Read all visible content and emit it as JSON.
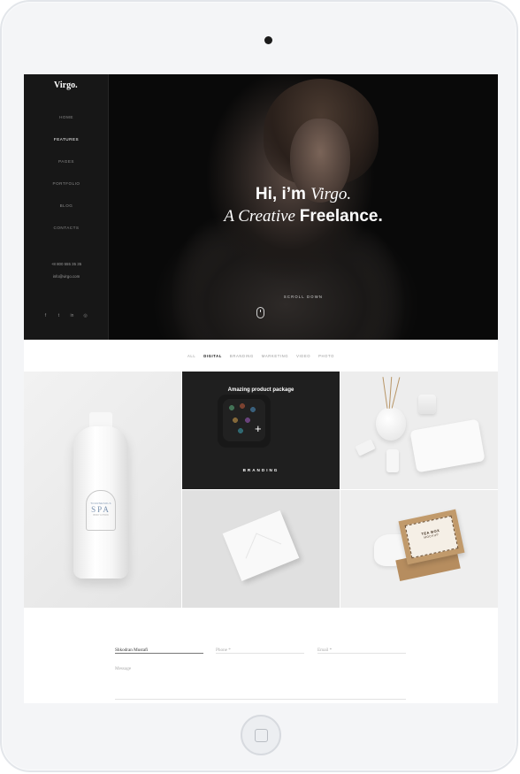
{
  "site": {
    "logo": "Virgo.",
    "nav": [
      "HOME",
      "FEATURES",
      "PAGES",
      "PORTFOLIO",
      "BLOG",
      "CONTACTS"
    ],
    "active_nav": "FEATURES",
    "phone": "+8 800 555 35 35",
    "email": "info@virgo.com",
    "socials": [
      "facebook-icon",
      "twitter-icon",
      "linkedin-icon",
      "instagram-icon"
    ]
  },
  "hero": {
    "greeting": "Hi, i’m",
    "name": "Virgo.",
    "line2_italic": "A Creative",
    "line2_bold": "Freelance.",
    "scroll_label": "SCROLL DOWN"
  },
  "filters": {
    "items": [
      "ALL",
      "DIGITAL",
      "BRANDING",
      "MARKETING",
      "VIDEO",
      "PHOTO"
    ],
    "active": "DIGITAL"
  },
  "portfolio": {
    "spa_brand": "TOURNESOLS",
    "spa_word": "SPA",
    "spa_sub": "BODY LOTION",
    "featured_title": "Amazing product  package",
    "featured_category": "BRANDING",
    "box_label_1": "TEA BOX",
    "box_label_2": "MOCKUP"
  },
  "form": {
    "name_value": "Shkodran Mustafi",
    "phone_placeholder": "Phone *",
    "email_placeholder": "Email *",
    "message_placeholder": "Message"
  }
}
